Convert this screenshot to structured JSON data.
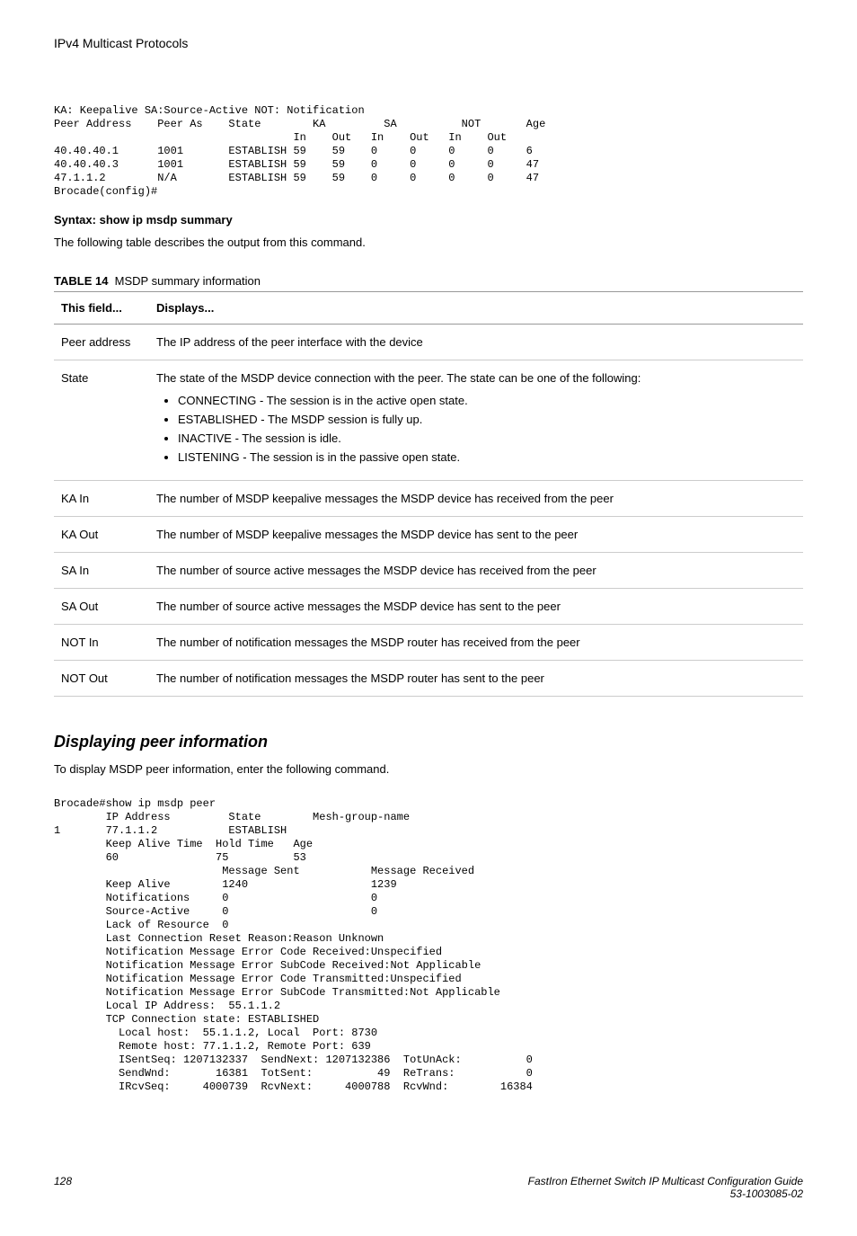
{
  "header": {
    "title": "IPv4 Multicast Protocols"
  },
  "cli_block1": "KA: Keepalive SA:Source-Active NOT: Notification\nPeer Address    Peer As    State        KA         SA          NOT       Age\n                                     In    Out   In    Out   In    Out\n40.40.40.1      1001       ESTABLISH 59    59    0     0     0     0     6\n40.40.40.3      1001       ESTABLISH 59    59    0     0     0     0     47\n47.1.1.2        N/A        ESTABLISH 59    59    0     0     0     0     47\nBrocade(config)#",
  "syntax": {
    "label": "Syntax:",
    "cmd": "show ip msdp summary"
  },
  "intro_text": "The following table describes the output from this command.",
  "table": {
    "caption_label": "TABLE 14",
    "caption_text": "MSDP summary information",
    "head_field": "This field...",
    "head_displays": "Displays...",
    "rows": [
      {
        "field": "Peer address",
        "desc": "The IP address of the peer interface with the device"
      },
      {
        "field": "State",
        "desc": "The state of the MSDP device connection with the peer. The state can be one of the following:",
        "bullets": [
          "CONNECTING - The session is in the active open state.",
          "ESTABLISHED - The MSDP session is fully up.",
          "INACTIVE - The session is idle.",
          "LISTENING - The session is in the passive open state."
        ]
      },
      {
        "field": "KA In",
        "desc": "The number of MSDP keepalive messages the MSDP device has received from the peer"
      },
      {
        "field": "KA Out",
        "desc": "The number of MSDP keepalive messages the MSDP device has sent to the peer"
      },
      {
        "field": "SA In",
        "desc": "The number of source active messages the MSDP device has received from the peer"
      },
      {
        "field": "SA Out",
        "desc": "The number of source active messages the MSDP device has sent to the peer"
      },
      {
        "field": "NOT In",
        "desc": "The number of notification messages the MSDP router has received from the peer"
      },
      {
        "field": "NOT Out",
        "desc": "The number of notification messages the MSDP router has sent to the peer"
      }
    ]
  },
  "section": {
    "heading": "Displaying peer information",
    "intro": "To display MSDP peer information, enter the following command."
  },
  "cli_block2": "Brocade#show ip msdp peer\n        IP Address         State        Mesh-group-name\n1       77.1.1.2           ESTABLISH\n        Keep Alive Time  Hold Time   Age\n        60               75          53\n                          Message Sent           Message Received\n        Keep Alive        1240                   1239\n        Notifications     0                      0\n        Source-Active     0                      0\n        Lack of Resource  0\n        Last Connection Reset Reason:Reason Unknown\n        Notification Message Error Code Received:Unspecified\n        Notification Message Error SubCode Received:Not Applicable\n        Notification Message Error Code Transmitted:Unspecified\n        Notification Message Error SubCode Transmitted:Not Applicable\n        Local IP Address:  55.1.1.2\n        TCP Connection state: ESTABLISHED\n          Local host:  55.1.1.2, Local  Port: 8730\n          Remote host: 77.1.1.2, Remote Port: 639\n          ISentSeq: 1207132337  SendNext: 1207132386  TotUnAck:          0\n          SendWnd:       16381  TotSent:          49  ReTrans:           0\n          IRcvSeq:     4000739  RcvNext:     4000788  RcvWnd:        16384",
  "footer": {
    "page": "128",
    "doc_title": "FastIron Ethernet Switch IP Multicast Configuration Guide",
    "doc_num": "53-1003085-02"
  }
}
